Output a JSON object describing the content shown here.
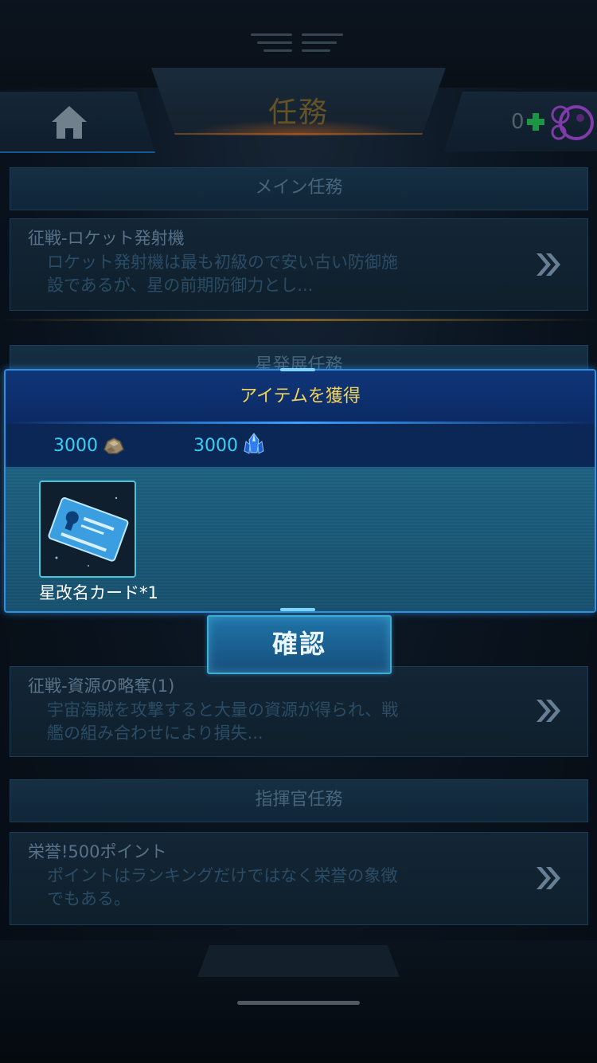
{
  "header": {
    "title": "任務",
    "home_icon": "home-icon",
    "resource_count": "0",
    "plus_icon": "plus-icon",
    "resource_icon": "purple-bubble-icon"
  },
  "sections": {
    "main": {
      "title": "メイン任務"
    },
    "planet": {
      "title": "星発展任務"
    },
    "commander": {
      "title": "指揮官任務"
    }
  },
  "cards": [
    {
      "title": "征戦-ロケット発射機",
      "desc_line1": "ロケット発射機は最も初級ので安い古い防御施",
      "desc_line2": "設であるが、星の前期防御力とし..."
    },
    {
      "title": "征戦-資源の略奪(1)",
      "desc_line1": "宇宙海賊を攻撃すると大量の資源が得られ、戦",
      "desc_line2": "艦の組み合わせにより損失..."
    },
    {
      "title": "栄誉!500ポイント",
      "desc_line1": "ポイントはランキングだけではなく栄誉の象徴",
      "desc_line2": "でもある。"
    }
  ],
  "popup": {
    "title": "アイテムを獲得",
    "resources": [
      {
        "value": "3000",
        "icon": "ore-icon"
      },
      {
        "value": "3000",
        "icon": "crystal-icon"
      }
    ],
    "item": {
      "label": "星改名カード*1",
      "icon": "rename-card-icon"
    },
    "confirm_label": "確認"
  },
  "colors": {
    "accent": "#2f8ee0",
    "popup_title": "#f0d35a",
    "resource_value": "#37d0f5"
  }
}
